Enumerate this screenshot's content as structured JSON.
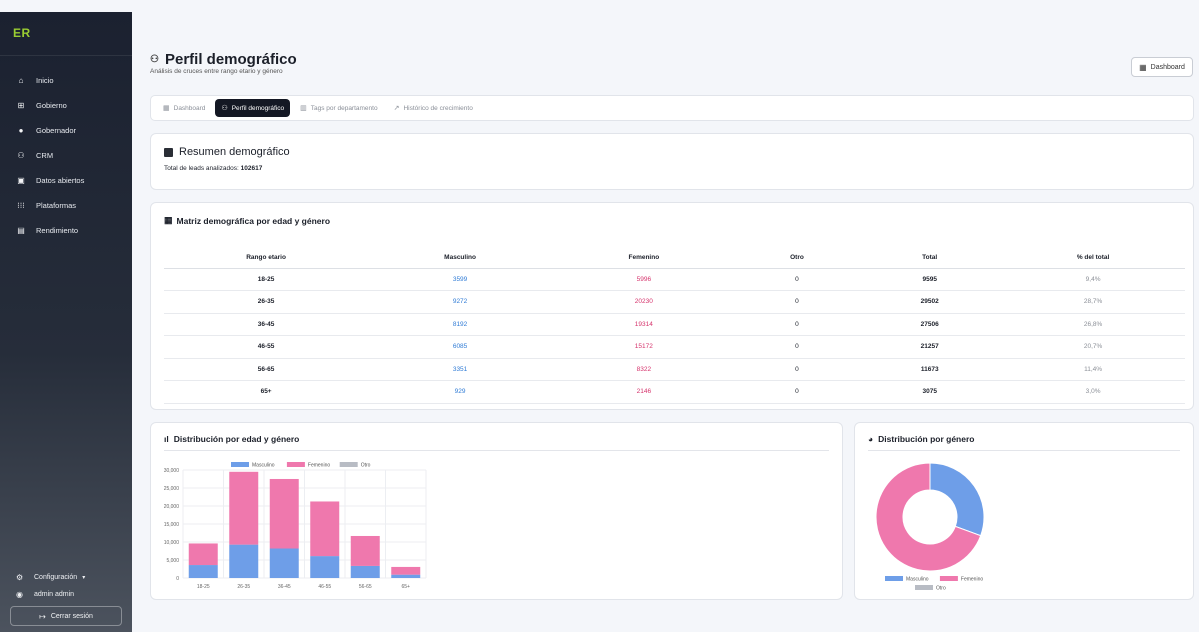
{
  "sidebar": {
    "logo": "ER",
    "items": [
      {
        "label": "Inicio"
      },
      {
        "label": "Gobierno"
      },
      {
        "label": "Gobernador"
      },
      {
        "label": "CRM"
      },
      {
        "label": "Datos abiertos"
      },
      {
        "label": "Plataformas"
      },
      {
        "label": "Rendimiento"
      }
    ],
    "settings_label": "Configuración",
    "settings_chevron": "▾",
    "user_label": "admin admin",
    "logout_label": "Cerrar sesión"
  },
  "header": {
    "title": "Perfil demográfico",
    "subtitle": "Análisis de cruces entre rango etario y género",
    "dashboard_button": "Dashboard"
  },
  "tabs": [
    {
      "label": "Dashboard"
    },
    {
      "label": "Perfil demográfico",
      "active": true
    },
    {
      "label": "Tags por departamento"
    },
    {
      "label": "Histórico de crecimiento"
    }
  ],
  "summary": {
    "title": "Resumen demográfico",
    "total_label": "Total de leads analizados:",
    "total_value": "102617"
  },
  "matrix": {
    "title": "Matriz demográfica por edad y género",
    "columns": [
      "Rango etario",
      "Masculino",
      "Femenino",
      "Otro",
      "Total",
      "% del total"
    ],
    "rows": [
      [
        "18-25",
        "3599",
        "5996",
        "0",
        "9595",
        "9,4%"
      ],
      [
        "26-35",
        "9272",
        "20230",
        "0",
        "29502",
        "28,7%"
      ],
      [
        "36-45",
        "8192",
        "19314",
        "0",
        "27506",
        "26,8%"
      ],
      [
        "46-55",
        "6085",
        "15172",
        "0",
        "21257",
        "20,7%"
      ],
      [
        "56-65",
        "3351",
        "8322",
        "0",
        "11673",
        "11,4%"
      ],
      [
        "65+",
        "929",
        "2146",
        "0",
        "3075",
        "3,0%"
      ]
    ]
  },
  "colors": {
    "masculino": "#6e9ee8",
    "femenino": "#ef78ad",
    "otro": "#b8bcc4",
    "accent_blue": "#2f7bd6",
    "accent_pink": "#d6336c"
  },
  "chart_data": [
    {
      "type": "bar",
      "stacked": true,
      "title": "Distribución por edad y género",
      "categories": [
        "18-25",
        "26-35",
        "36-45",
        "46-55",
        "56-65",
        "65+"
      ],
      "series": [
        {
          "name": "Masculino",
          "values": [
            3599,
            9272,
            8192,
            6085,
            3351,
            929
          ]
        },
        {
          "name": "Femenino",
          "values": [
            5996,
            20230,
            19314,
            15172,
            8322,
            2146
          ]
        },
        {
          "name": "Otro",
          "values": [
            0,
            0,
            0,
            0,
            0,
            0
          ]
        }
      ],
      "ylim": [
        0,
        30000
      ],
      "yticks": [
        "0",
        "5,000",
        "10,000",
        "15,000",
        "20,000",
        "25,000",
        "30,000"
      ],
      "legend": "top",
      "grid": true
    },
    {
      "type": "pie",
      "donut": true,
      "title": "Distribución por género",
      "labels": [
        "Masculino",
        "Femenino",
        "Otro"
      ],
      "values": [
        31428,
        71180,
        0
      ],
      "legend": "bottom"
    }
  ]
}
